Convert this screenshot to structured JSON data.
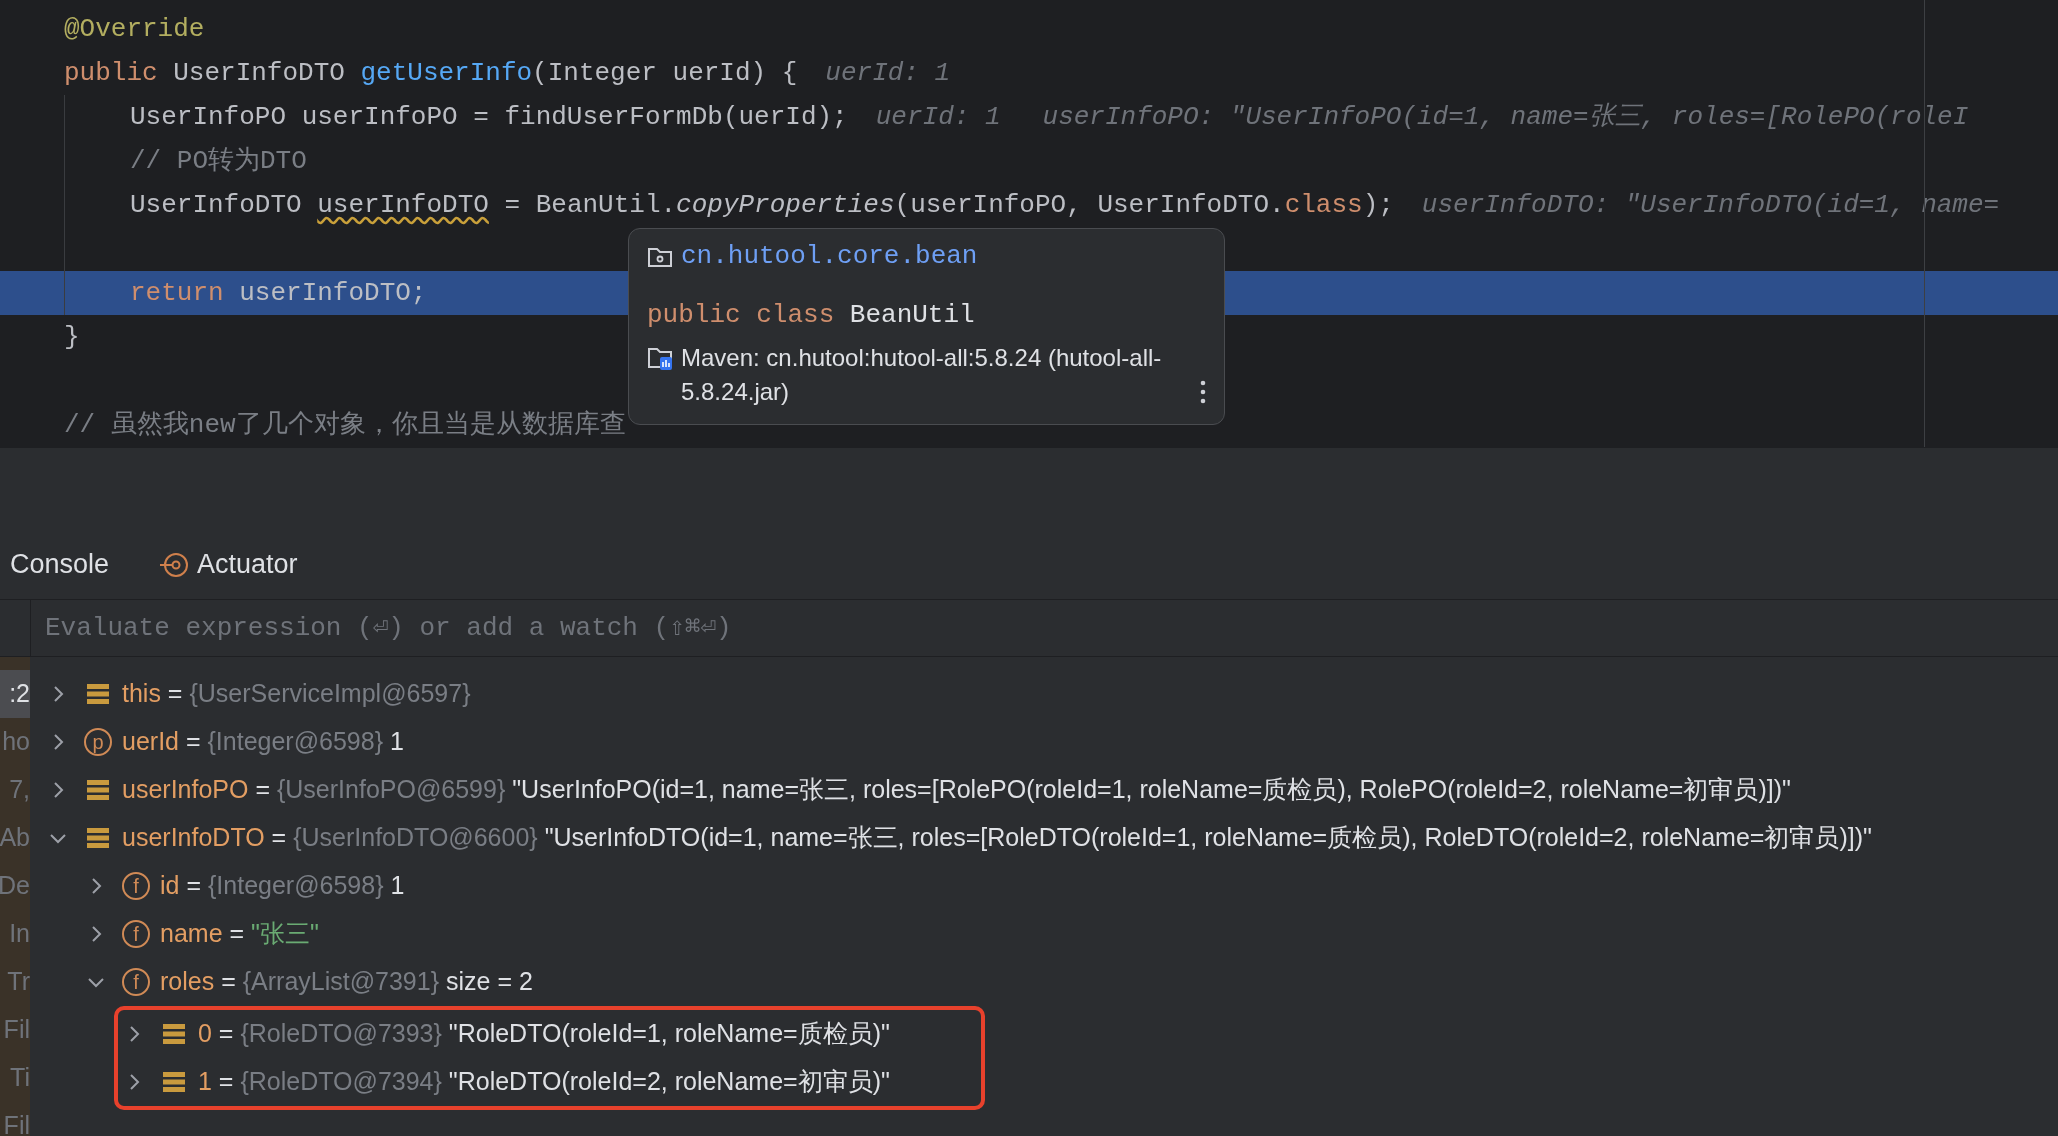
{
  "code_lines": [
    {
      "highlighted": false,
      "tokens": [
        {
          "kind": "annotation",
          "text": "@Override"
        }
      ]
    },
    {
      "highlighted": false,
      "tokens": [
        {
          "kind": "keyword",
          "text": "public"
        },
        {
          "kind": "plain",
          "text": " UserInfoDTO "
        },
        {
          "kind": "method",
          "text": "getUserInfo"
        },
        {
          "kind": "plain",
          "text": "(Integer uerId) {"
        }
      ],
      "hints": [
        "uerId: 1"
      ],
      "children": [
        {
          "highlighted": false,
          "tokens": [
            {
              "kind": "plain",
              "text": "UserInfoPO userInfoPO = findUserFormDb(uerId);"
            }
          ],
          "hints": [
            "uerId: 1",
            "userInfoPO: \"UserInfoPO(id=1, name=张三, roles=[RolePO(roleI"
          ]
        },
        {
          "highlighted": false,
          "tokens": [
            {
              "kind": "comment",
              "text": "// PO转为DTO"
            }
          ]
        },
        {
          "highlighted": false,
          "tokens": [
            {
              "kind": "plain",
              "text": "UserInfoDTO "
            },
            {
              "kind": "warning",
              "text": "userInfoDTO"
            },
            {
              "kind": "plain",
              "text": " = BeanUtil."
            },
            {
              "kind": "static",
              "text": "copyProperties"
            },
            {
              "kind": "plain",
              "text": "(userInfoPO, UserInfoDTO."
            },
            {
              "kind": "keyword",
              "text": "class"
            },
            {
              "kind": "plain",
              "text": ");"
            }
          ],
          "hints": [
            "userInfoDTO: \"UserInfoDTO(id=1, name="
          ]
        },
        {
          "highlighted": false
        },
        {
          "highlighted": true,
          "tokens": [
            {
              "kind": "keyword",
              "text": "return"
            },
            {
              "kind": "plain",
              "text": " userInfoDTO;"
            }
          ]
        }
      ]
    },
    {
      "highlighted": false,
      "tokens": [
        {
          "kind": "plain",
          "text": "}"
        }
      ]
    },
    {
      "highlighted": false
    },
    {
      "highlighted": false,
      "tokens": [
        {
          "kind": "comment",
          "text": "// 虽然我new了几个对象，你且当是从数据库查"
        }
      ]
    }
  ],
  "tooltip": {
    "package": "cn.hutool.core.bean",
    "declaration": [
      {
        "kind": "keyword",
        "text": "public class"
      },
      {
        "kind": "plain",
        "text": " BeanUtil"
      }
    ],
    "library": "Maven: cn.hutool:hutool-all:5.8.24 (hutool-all-5.8.24.jar)"
  },
  "tabs": [
    {
      "label": "Console",
      "selected": false,
      "kind": "plain"
    },
    {
      "label": "Actuator",
      "selected": false,
      "kind": "tool"
    }
  ],
  "evaluate": {
    "placeholder": "Evaluate expression (⏎) or add a watch (⇧⌘⏎)"
  },
  "frames": [
    {
      "label": ":2",
      "selected": true
    },
    {
      "label": "ho",
      "selected": false
    },
    {
      "label": "7,",
      "selected": false
    },
    {
      "label": "Ab",
      "selected": false
    },
    {
      "label": "De",
      "selected": false
    },
    {
      "label": "In",
      "selected": false
    },
    {
      "label": "Tr",
      "selected": false
    },
    {
      "label": "Fil",
      "selected": false
    },
    {
      "label": "Ti",
      "selected": false
    },
    {
      "label": "Fil",
      "selected": false
    }
  ],
  "variables": [
    {
      "name": "this",
      "kind": "object",
      "eq": "=",
      "type": "{UserServiceImpl@6597}",
      "expanded": false
    },
    {
      "name": "uerId",
      "kind": "param",
      "badge": "p",
      "eq": "=",
      "type": "{Integer@6598}",
      "value": "1",
      "expanded": false
    },
    {
      "name": "userInfoPO",
      "kind": "object",
      "eq": "=",
      "type": "{UserInfoPO@6599}",
      "value": "\"UserInfoPO(id=1, name=张三, roles=[RolePO(roleId=1, roleName=质检员), RolePO(roleId=2, roleName=初审员)])\"",
      "expanded": false
    },
    {
      "name": "userInfoDTO",
      "kind": "object",
      "eq": "=",
      "type": "{UserInfoDTO@6600}",
      "value": "\"UserInfoDTO(id=1, name=张三, roles=[RoleDTO(roleId=1, roleName=质检员), RoleDTO(roleId=2, roleName=初审员)])\"",
      "expanded": true,
      "children": [
        {
          "name": "id",
          "kind": "field",
          "badge": "f",
          "eq": "=",
          "type": "{Integer@6598}",
          "value": "1",
          "expanded": false
        },
        {
          "name": "name",
          "kind": "field",
          "badge": "f",
          "eq": "=",
          "value": "\"张三\"",
          "string": true,
          "expanded": false
        },
        {
          "name": "roles",
          "kind": "field",
          "badge": "f",
          "eq": "=",
          "type": "{ArrayList@7391}",
          "value": "size = 2",
          "expanded": true,
          "outlined_children": true,
          "children": [
            {
              "name": "0",
              "kind": "object",
              "eq": "=",
              "type": "{RoleDTO@7393}",
              "value": "\"RoleDTO(roleId=1, roleName=质检员)\"",
              "expanded": false
            },
            {
              "name": "1",
              "kind": "object",
              "eq": "=",
              "type": "{RoleDTO@7394}",
              "value": "\"RoleDTO(roleId=2, roleName=初审员)\"",
              "expanded": false
            }
          ]
        }
      ]
    }
  ]
}
